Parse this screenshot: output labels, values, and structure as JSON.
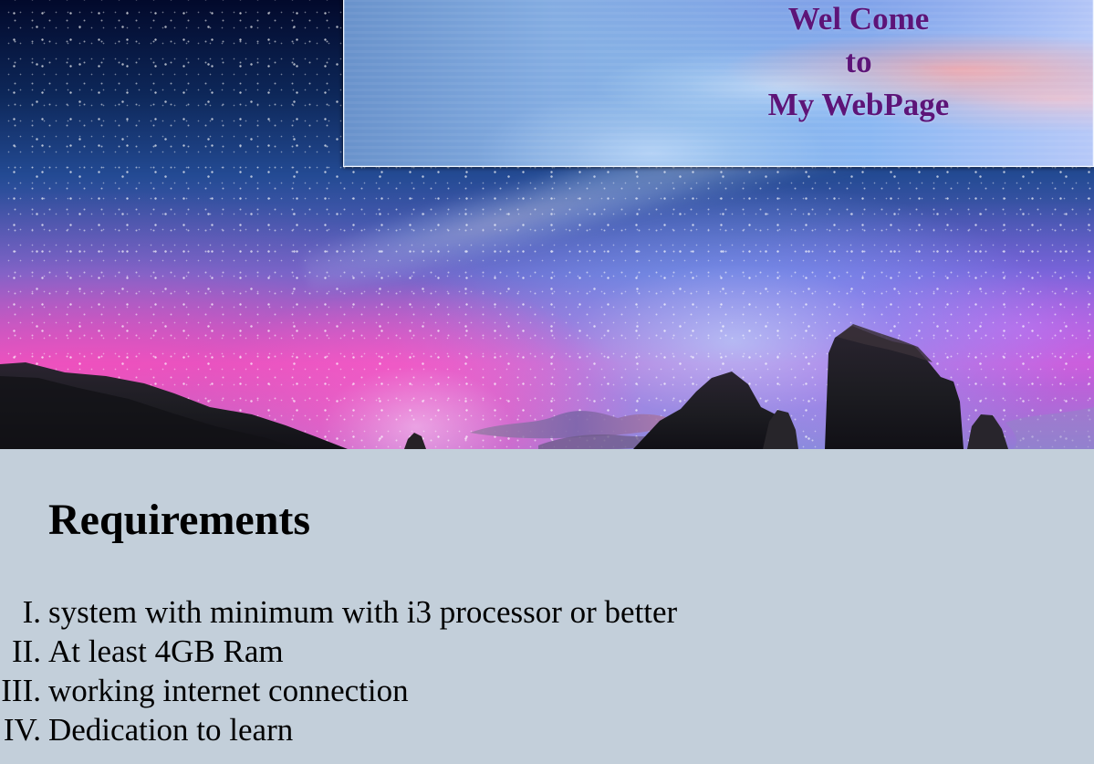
{
  "welcome": {
    "line1": "Wel Come",
    "line2": "to",
    "line3": "My WebPage"
  },
  "requirements": {
    "heading": "Requirements",
    "items": [
      {
        "marker": "I.",
        "text": "system with minimum with i3 processor or better"
      },
      {
        "marker": "II.",
        "text": "At least 4GB Ram"
      },
      {
        "marker": "III.",
        "text": "working internet connection"
      },
      {
        "marker": "IV.",
        "text": "Dedication to learn"
      }
    ]
  },
  "colors": {
    "page_background": "#c3cfda",
    "welcome_text": "#5b1574",
    "heading_text": "#000000"
  }
}
